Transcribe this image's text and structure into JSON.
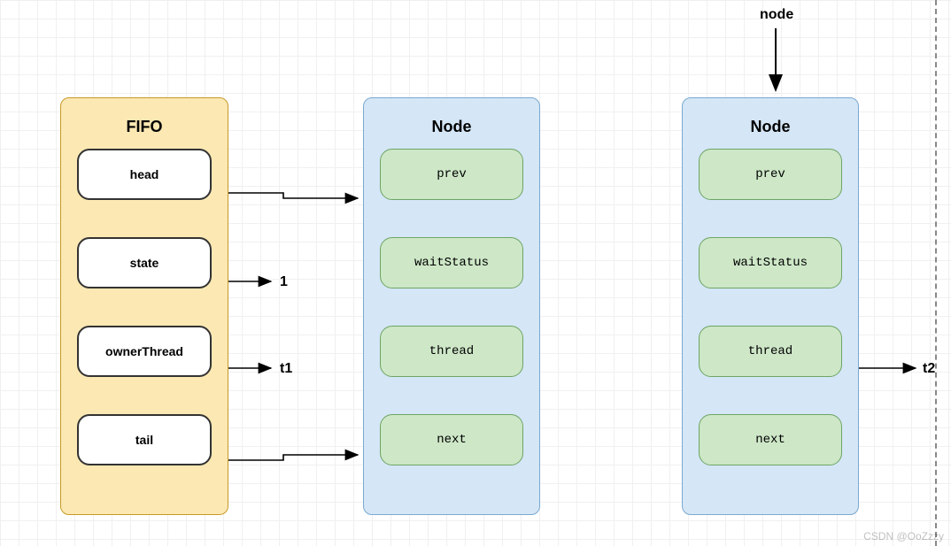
{
  "fifo": {
    "title": "FIFO",
    "slots": [
      "head",
      "state",
      "ownerThread",
      "tail"
    ]
  },
  "node1": {
    "title": "Node",
    "slots": [
      "prev",
      "waitStatus",
      "thread",
      "next"
    ]
  },
  "node2": {
    "title": "Node",
    "slots": [
      "prev",
      "waitStatus",
      "thread",
      "next"
    ]
  },
  "labels": {
    "nodePointer": "node",
    "stateValue": "1",
    "ownerThreadValue": "t1",
    "node2ThreadValue": "t2"
  },
  "watermark": "CSDN @OoZzzy"
}
